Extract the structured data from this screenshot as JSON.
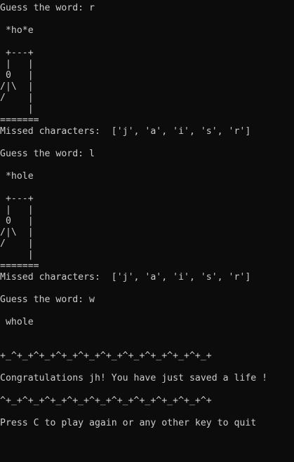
{
  "terminal": {
    "lines": [
      "Guess the word: r",
      " *ho*e",
      " +---+",
      " |   |",
      " 0   |",
      "/|\\  |",
      "/    |",
      "     |",
      "=======",
      "Missed characters:  ['j', 'a', 'i', 's', 'r']",
      "Guess the word: l",
      " *hole",
      " +---+",
      " |   |",
      " 0   |",
      "/|\\  |",
      "/    |",
      "     |",
      "=======",
      "Missed characters:  ['j', 'a', 'i', 's', 'r']",
      "Guess the word: w",
      " whole",
      "+_^+_+^+_+^+_+^+_+^+_+^+_+^+_+^+_+^+_+",
      "Congratulations jh! You have just saved a life !",
      "^+_+^+_+^+_+^+_+^+_+^+_+^+_+^+_+^+_+^+",
      "Press C to play again or any other key to quit"
    ]
  }
}
